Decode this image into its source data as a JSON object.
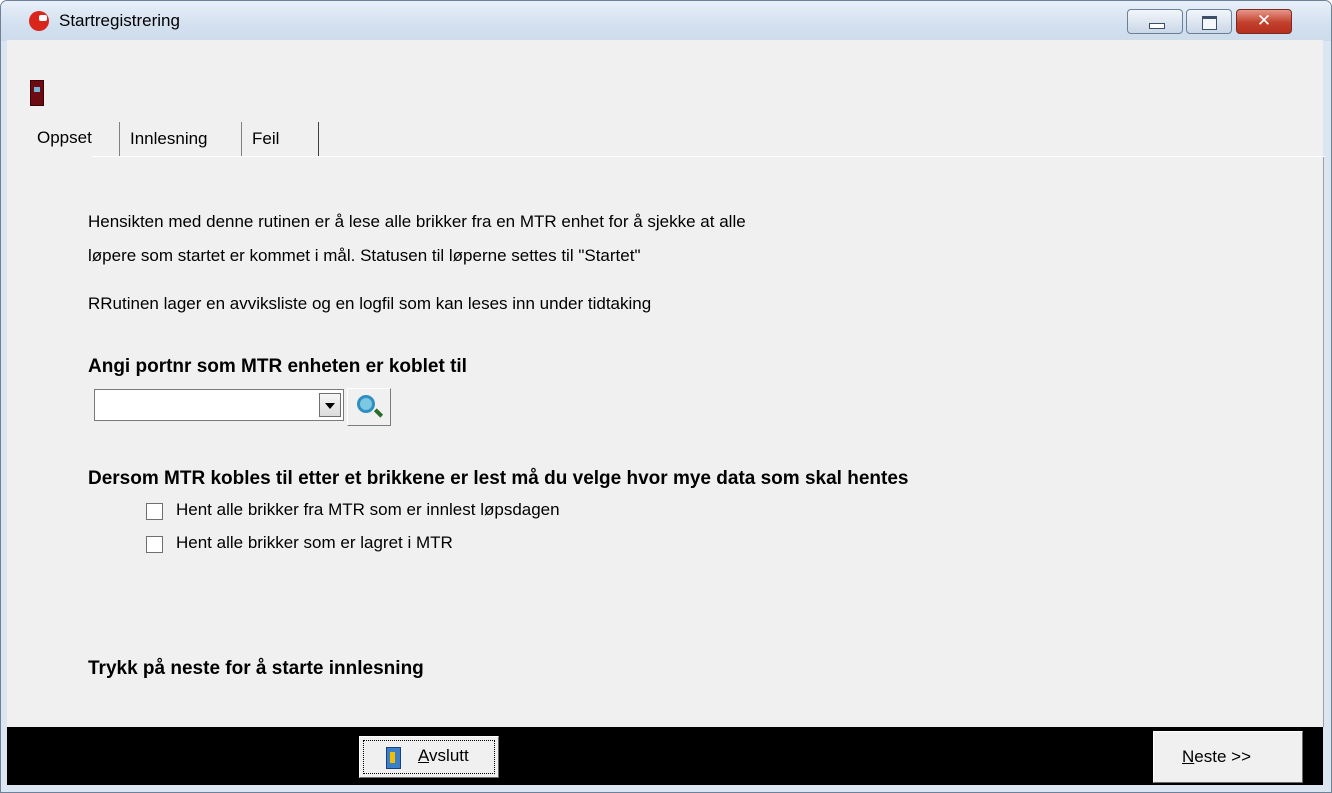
{
  "window": {
    "title": "Startregistrering",
    "close_glyph": "✕"
  },
  "tabs": {
    "oppset": "Oppset",
    "innlesning": "Innlesning",
    "feil": "Feil"
  },
  "content": {
    "description_line1": "Hensikten med denne rutinen er å lese alle brikker fra en MTR enhet for å sjekke at alle",
    "description_line2": "løpere som startet er kommet i mål. Statusen til løperne settes til \"Startet\"",
    "description_line3": "RRutinen lager en avviksliste og en logfil som kan leses inn under tidtaking",
    "port_heading": "Angi portnr som MTR enheten er koblet til",
    "port_value": "",
    "data_heading": "Dersom MTR kobles til etter et brikkene er lest må du velge hvor mye data som skal hentes",
    "checkbox1_label": "Hent alle brikker fra MTR som er innlest løpsdagen",
    "checkbox1_checked": false,
    "checkbox2_label": "Hent alle brikker som er lagret i MTR",
    "checkbox2_checked": false,
    "instruction": "Trykk på neste for å starte innlesning"
  },
  "buttons": {
    "avslutt_first": "A",
    "avslutt_rest": "vslutt",
    "neste_first": "N",
    "neste_rest": "este >>"
  },
  "icons": {
    "app": "app-logo-icon",
    "door": "exit-door-icon",
    "search": "search-icon",
    "exit": "exit-icon"
  },
  "colors": {
    "titlebar": "#d3e0ef",
    "close_button": "#c2402c",
    "bottom_bar": "#000000",
    "panel": "#f0f0f0"
  }
}
